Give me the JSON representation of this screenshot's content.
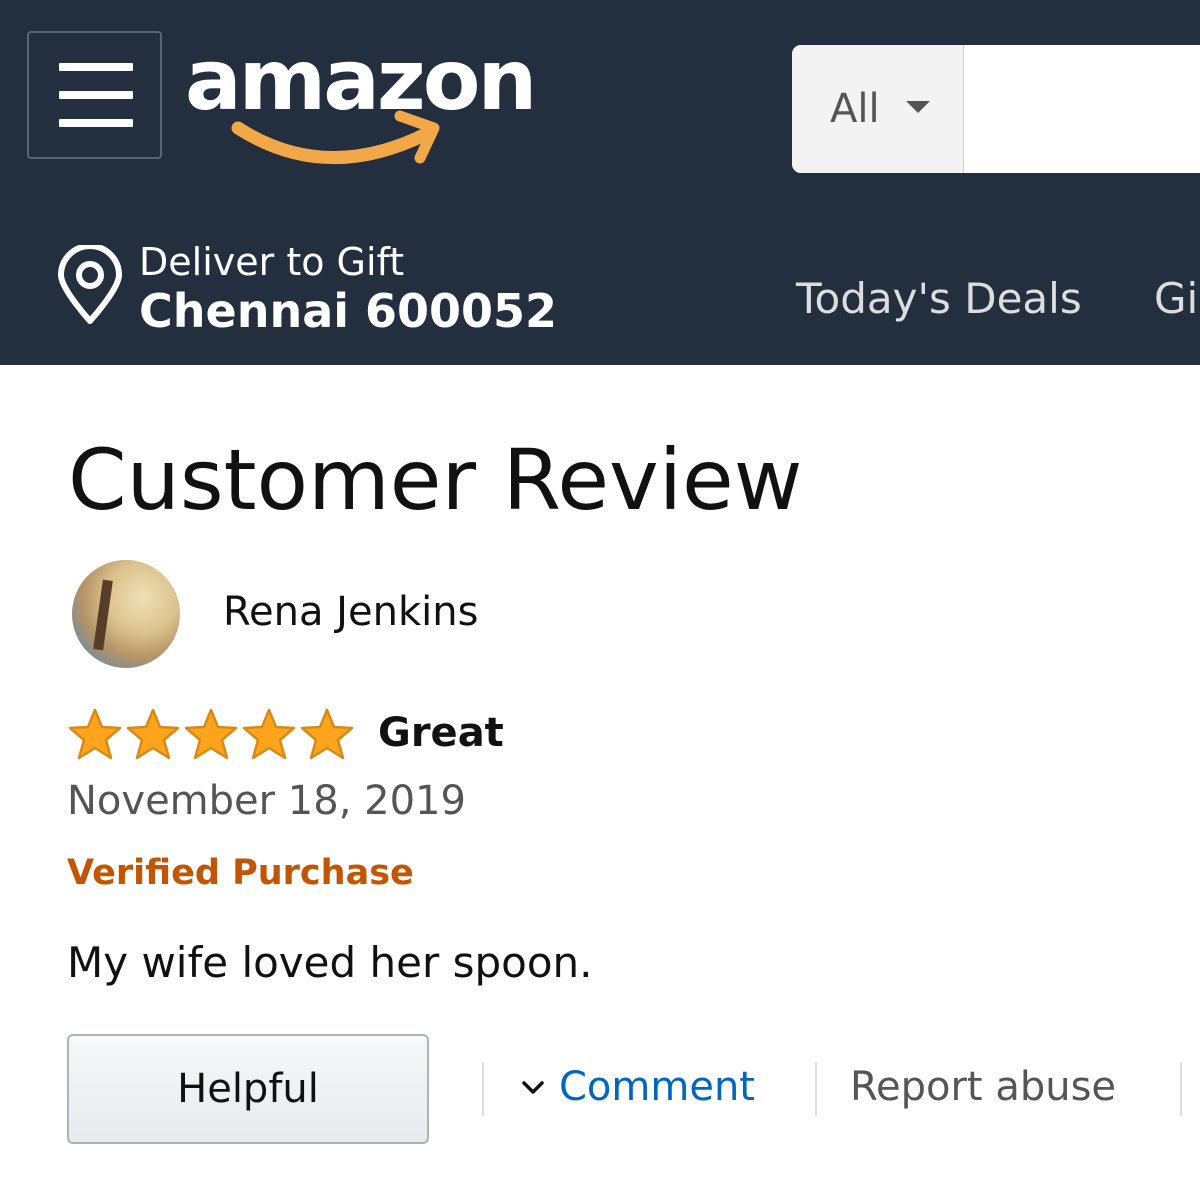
{
  "header": {
    "logo_text": "amazon",
    "search": {
      "category_label": "All"
    },
    "location": {
      "line1": "Deliver to Gift",
      "line2": "Chennai 600052"
    },
    "nav_links": [
      "Today's Deals",
      "Gi"
    ]
  },
  "page": {
    "title": "Customer Review"
  },
  "review": {
    "reviewer_name": "Rena Jenkins",
    "rating": 5,
    "rating_max": 5,
    "headline": "Great",
    "date": "November 18, 2019",
    "verified_label": "Verified Purchase",
    "body": "My wife loved her spoon."
  },
  "actions": {
    "helpful_label": "Helpful",
    "comment_label": "Comment",
    "report_label": "Report abuse"
  },
  "icons": {
    "menu": "hamburger-menu-icon",
    "logo_smile": "amazon-smile-arrow-icon",
    "dropdown": "caret-down-icon",
    "location": "location-pin-icon",
    "star": "star-icon",
    "comment_chevron": "chevron-down-icon"
  },
  "colors": {
    "header_bg": "#232f3e",
    "logo_orange": "#f3a847",
    "star_fill": "#ffa41c",
    "verified": "#c45500",
    "link": "#0066c0"
  }
}
